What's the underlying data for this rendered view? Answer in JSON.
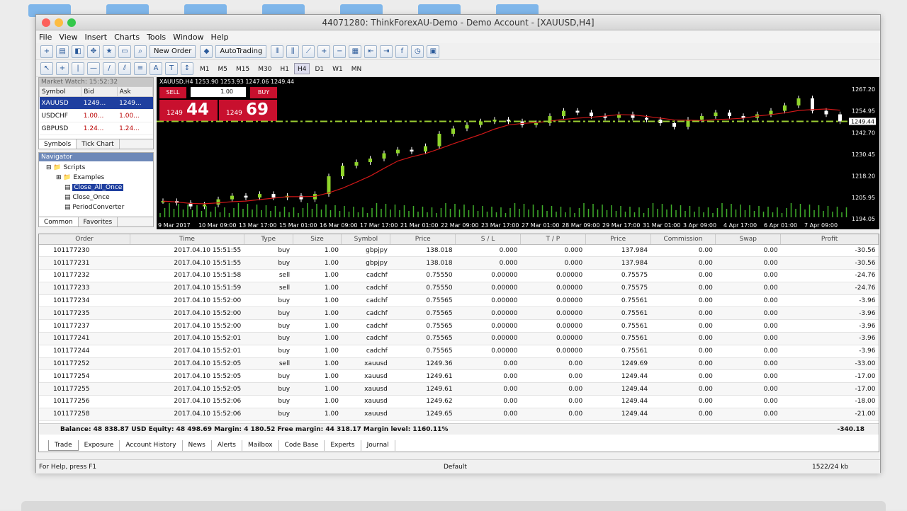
{
  "window_title": "44071280: ThinkForexAU-Demo - Demo Account - [XAUUSD,H4]",
  "menu": [
    "File",
    "View",
    "Insert",
    "Charts",
    "Tools",
    "Window",
    "Help"
  ],
  "toolbar": {
    "new_order": "New Order",
    "autotrading": "AutoTrading"
  },
  "timeframes": [
    "M1",
    "M5",
    "M15",
    "M30",
    "H1",
    "H4",
    "D1",
    "W1",
    "MN"
  ],
  "timeframe_selected": "H4",
  "market_watch": {
    "title": "Market Watch: 15:52:32",
    "headers": [
      "Symbol",
      "Bid",
      "Ask"
    ],
    "rows": [
      {
        "symbol": "XAUUSD",
        "bid": "1249...",
        "ask": "1249..."
      },
      {
        "symbol": "USDCHF",
        "bid": "1.00...",
        "ask": "1.00..."
      },
      {
        "symbol": "GBPUSD",
        "bid": "1.24...",
        "ask": "1.24..."
      }
    ],
    "tabs": [
      "Symbols",
      "Tick Chart"
    ]
  },
  "navigator": {
    "title": "Navigator",
    "items": [
      "Scripts",
      "Examples",
      "Close_All_Once",
      "Close_Once",
      "PeriodConverter"
    ],
    "tabs": [
      "Common",
      "Favorites"
    ]
  },
  "chart": {
    "header": "XAUUSD,H4 1253.90 1253.93 1247.06 1249.44",
    "sell_label": "SELL",
    "buy_label": "BUY",
    "lot": "1.00",
    "sell_price_small": "1249",
    "sell_price_big": "44",
    "buy_price_small": "1249",
    "buy_price_big": "69",
    "price_tag": "1249.44",
    "y_ticks": [
      "1267.20",
      "1254.95",
      "1242.70",
      "1230.45",
      "1218.20",
      "1205.95",
      "1194.05"
    ],
    "x_ticks": [
      "9 Mar 2017",
      "10 Mar 09:00",
      "13 Mar 17:00",
      "15 Mar 01:00",
      "16 Mar 09:00",
      "17 Mar 17:00",
      "21 Mar 01:00",
      "22 Mar 09:00",
      "23 Mar 17:00",
      "27 Mar 01:00",
      "28 Mar 09:00",
      "29 Mar 17:00",
      "31 Mar 01:00",
      "3 Apr 09:00",
      "4 Apr 17:00",
      "6 Apr 01:00",
      "7 Apr 09:00"
    ]
  },
  "chart_data": {
    "type": "line",
    "title": "XAUUSD,H4",
    "ylim": [
      1194.05,
      1267.2
    ],
    "series": [
      {
        "name": "XAUUSD",
        "values": [
          1204,
          1203,
          1201,
          1202,
          1205,
          1207,
          1206,
          1208,
          1206,
          1207,
          1205,
          1208,
          1218,
          1224,
          1226,
          1228,
          1231,
          1233,
          1232,
          1235,
          1242,
          1245,
          1247,
          1249,
          1250,
          1249,
          1247,
          1248,
          1252,
          1255,
          1254,
          1252,
          1251,
          1253,
          1251,
          1250,
          1248,
          1246,
          1250,
          1252,
          1254,
          1252,
          1251,
          1253,
          1255,
          1258,
          1262,
          1255,
          1253,
          1249
        ]
      }
    ]
  },
  "terminal": {
    "headers": [
      "Order",
      "Time",
      "Type",
      "Size",
      "Symbol",
      "Price",
      "S / L",
      "T / P",
      "Price",
      "Commission",
      "Swap",
      "Profit"
    ],
    "rows": [
      [
        "101177230",
        "2017.04.10 15:51:55",
        "buy",
        "1.00",
        "gbpjpy",
        "138.018",
        "0.000",
        "0.000",
        "137.984",
        "0.00",
        "0.00",
        "-30.56"
      ],
      [
        "101177231",
        "2017.04.10 15:51:55",
        "buy",
        "1.00",
        "gbpjpy",
        "138.018",
        "0.000",
        "0.000",
        "137.984",
        "0.00",
        "0.00",
        "-30.56"
      ],
      [
        "101177232",
        "2017.04.10 15:51:58",
        "sell",
        "1.00",
        "cadchf",
        "0.75550",
        "0.00000",
        "0.00000",
        "0.75575",
        "0.00",
        "0.00",
        "-24.76"
      ],
      [
        "101177233",
        "2017.04.10 15:51:59",
        "sell",
        "1.00",
        "cadchf",
        "0.75550",
        "0.00000",
        "0.00000",
        "0.75575",
        "0.00",
        "0.00",
        "-24.76"
      ],
      [
        "101177234",
        "2017.04.10 15:52:00",
        "buy",
        "1.00",
        "cadchf",
        "0.75565",
        "0.00000",
        "0.00000",
        "0.75561",
        "0.00",
        "0.00",
        "-3.96"
      ],
      [
        "101177235",
        "2017.04.10 15:52:00",
        "buy",
        "1.00",
        "cadchf",
        "0.75565",
        "0.00000",
        "0.00000",
        "0.75561",
        "0.00",
        "0.00",
        "-3.96"
      ],
      [
        "101177237",
        "2017.04.10 15:52:00",
        "buy",
        "1.00",
        "cadchf",
        "0.75565",
        "0.00000",
        "0.00000",
        "0.75561",
        "0.00",
        "0.00",
        "-3.96"
      ],
      [
        "101177241",
        "2017.04.10 15:52:01",
        "buy",
        "1.00",
        "cadchf",
        "0.75565",
        "0.00000",
        "0.00000",
        "0.75561",
        "0.00",
        "0.00",
        "-3.96"
      ],
      [
        "101177244",
        "2017.04.10 15:52:01",
        "buy",
        "1.00",
        "cadchf",
        "0.75565",
        "0.00000",
        "0.00000",
        "0.75561",
        "0.00",
        "0.00",
        "-3.96"
      ],
      [
        "101177252",
        "2017.04.10 15:52:05",
        "sell",
        "1.00",
        "xauusd",
        "1249.36",
        "0.00",
        "0.00",
        "1249.69",
        "0.00",
        "0.00",
        "-33.00"
      ],
      [
        "101177254",
        "2017.04.10 15:52:05",
        "buy",
        "1.00",
        "xauusd",
        "1249.61",
        "0.00",
        "0.00",
        "1249.44",
        "0.00",
        "0.00",
        "-17.00"
      ],
      [
        "101177255",
        "2017.04.10 15:52:05",
        "buy",
        "1.00",
        "xauusd",
        "1249.61",
        "0.00",
        "0.00",
        "1249.44",
        "0.00",
        "0.00",
        "-17.00"
      ],
      [
        "101177256",
        "2017.04.10 15:52:06",
        "buy",
        "1.00",
        "xauusd",
        "1249.62",
        "0.00",
        "0.00",
        "1249.44",
        "0.00",
        "0.00",
        "-18.00"
      ],
      [
        "101177258",
        "2017.04.10 15:52:06",
        "buy",
        "1.00",
        "xauusd",
        "1249.65",
        "0.00",
        "0.00",
        "1249.44",
        "0.00",
        "0.00",
        "-21.00"
      ]
    ],
    "balance": "Balance: 48 838.87 USD  Equity: 48 498.69  Margin: 4 180.52  Free margin: 44 318.17  Margin level: 1160.11%",
    "total": "-340.18",
    "tabs": [
      "Trade",
      "Exposure",
      "Account History",
      "News",
      "Alerts",
      "Mailbox",
      "Code Base",
      "Experts",
      "Journal"
    ],
    "side_label": "Terminal"
  },
  "status": {
    "help": "For Help, press F1",
    "profile": "Default",
    "traffic": "1522/24 kb"
  }
}
